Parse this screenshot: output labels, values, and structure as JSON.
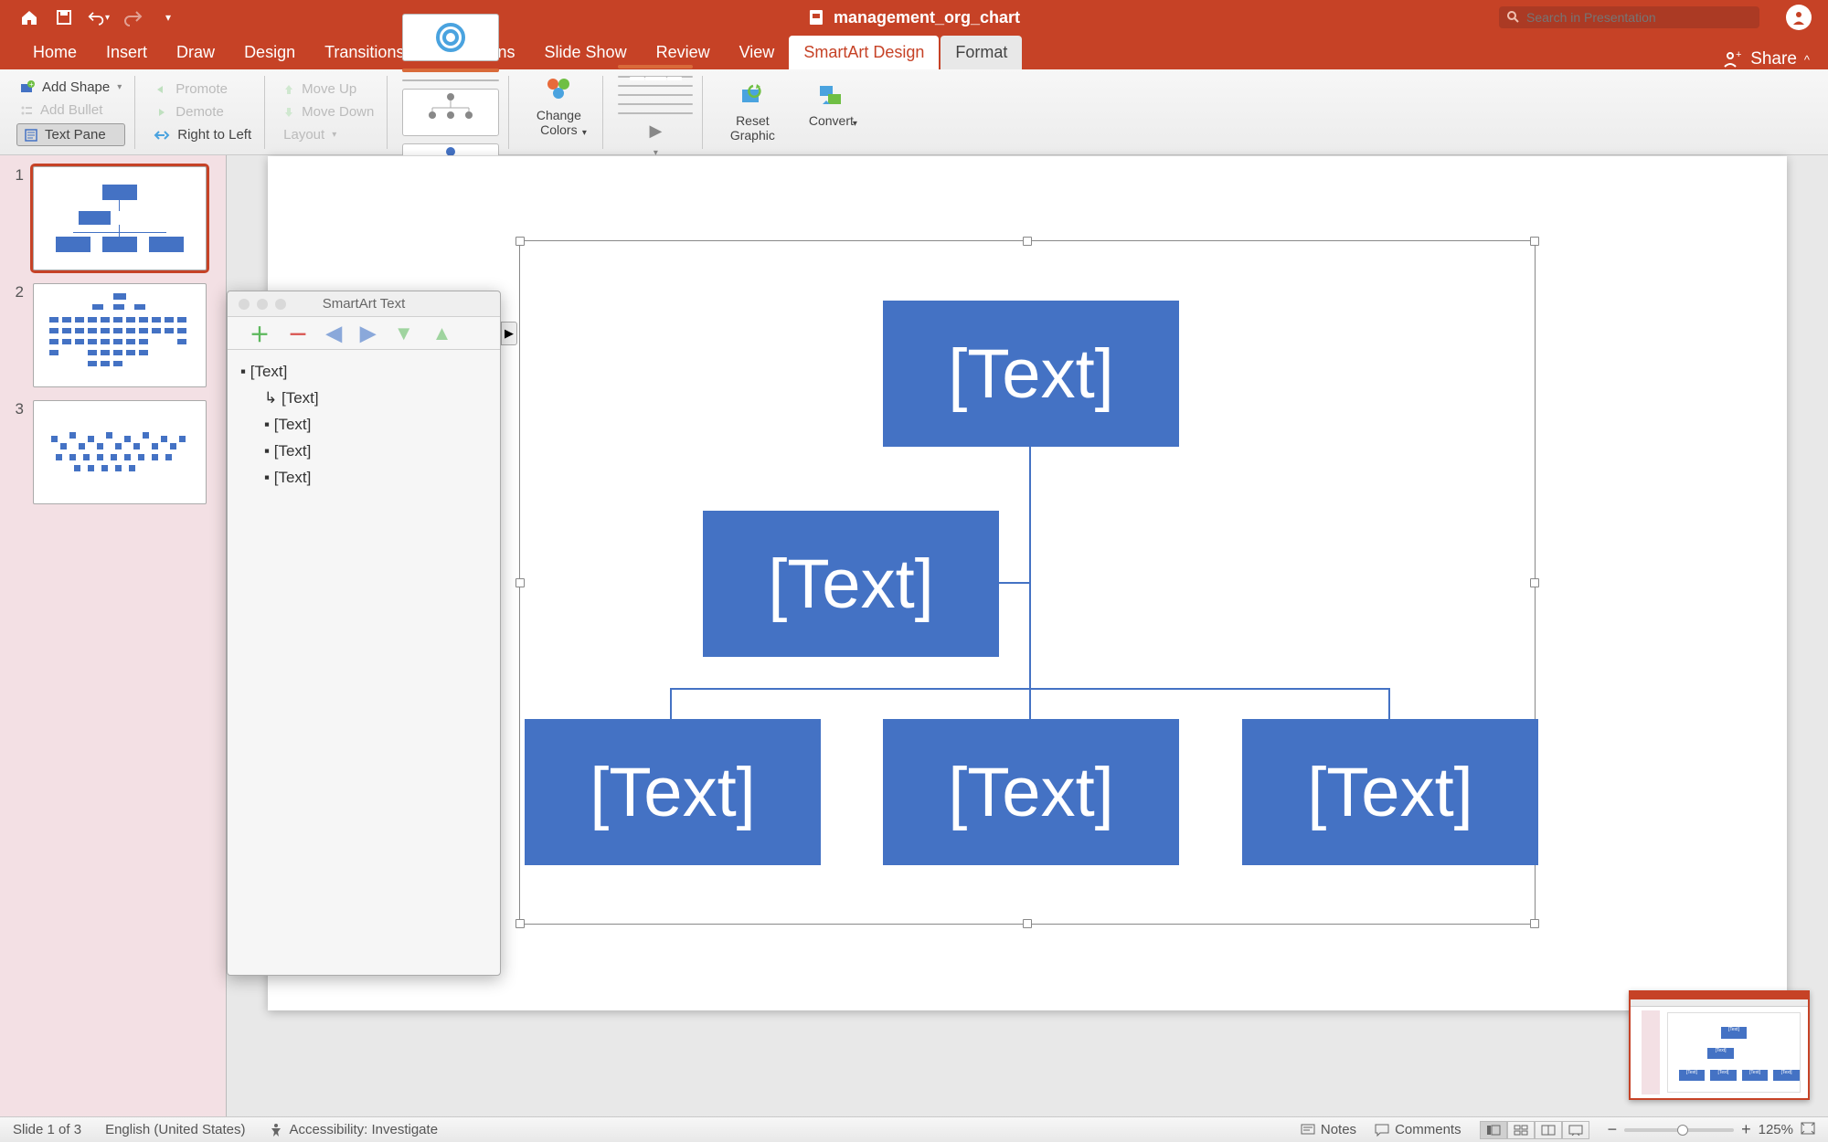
{
  "titlebar": {
    "document_name": "management_org_chart",
    "search_placeholder": "Search in Presentation"
  },
  "tabs": {
    "items": [
      "Home",
      "Insert",
      "Draw",
      "Design",
      "Transitions",
      "Animations",
      "Slide Show",
      "Review",
      "View",
      "SmartArt Design",
      "Format"
    ],
    "active": "SmartArt Design",
    "share_label": "Share"
  },
  "ribbon": {
    "add_shape": "Add Shape",
    "add_bullet": "Add Bullet",
    "text_pane": "Text Pane",
    "promote": "Promote",
    "demote": "Demote",
    "right_to_left": "Right to Left",
    "move_up": "Move Up",
    "move_down": "Move Down",
    "layout": "Layout",
    "change_colors": "Change\nColors",
    "reset_graphic": "Reset\nGraphic",
    "convert": "Convert"
  },
  "textpane": {
    "title": "SmartArt Text",
    "items": [
      {
        "level": 1,
        "text": "[Text]"
      },
      {
        "level": 2,
        "text": "[Text]",
        "arrow": true
      },
      {
        "level": 2,
        "text": "[Text]"
      },
      {
        "level": 2,
        "text": "[Text]"
      },
      {
        "level": 2,
        "text": "[Text]"
      }
    ]
  },
  "smartart": {
    "boxes": {
      "top": "[Text]",
      "assistant": "[Text]",
      "child1": "[Text]",
      "child2": "[Text]",
      "child3": "[Text]"
    }
  },
  "slides": {
    "count": 3,
    "current": 1
  },
  "statusbar": {
    "slide_info": "Slide 1 of 3",
    "language": "English (United States)",
    "accessibility": "Accessibility: Investigate",
    "notes": "Notes",
    "comments": "Comments",
    "zoom": "125%"
  },
  "chart_data": {
    "type": "hierarchy",
    "title": "",
    "nodes": [
      {
        "id": "n1",
        "label": "[Text]",
        "parent": null,
        "role": "root"
      },
      {
        "id": "n2",
        "label": "[Text]",
        "parent": "n1",
        "role": "assistant"
      },
      {
        "id": "n3",
        "label": "[Text]",
        "parent": "n1",
        "role": "child"
      },
      {
        "id": "n4",
        "label": "[Text]",
        "parent": "n1",
        "role": "child"
      },
      {
        "id": "n5",
        "label": "[Text]",
        "parent": "n1",
        "role": "child"
      }
    ]
  }
}
